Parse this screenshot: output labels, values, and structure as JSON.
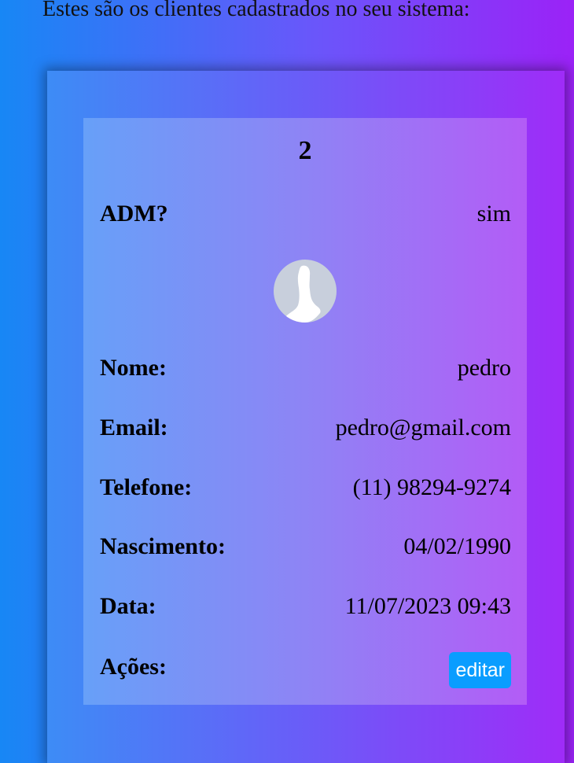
{
  "intro_text": "Estes são os clientes cadastrados no seu sistema:",
  "client": {
    "id": "2",
    "admin_label": "ADM?",
    "admin_value": "sim",
    "avatar_icon": "default-user-silhouette-icon",
    "fields": {
      "name_label": "Nome:",
      "name_value": "pedro",
      "email_label": "Email:",
      "email_value": "pedro@gmail.com",
      "phone_label": "Telefone:",
      "phone_value": "(11) 98294-9274",
      "birth_label": "Nascimento:",
      "birth_value": "04/02/1990",
      "date_label": "Data:",
      "date_value": "11/07/2023 09:43",
      "actions_label": "Ações:"
    },
    "edit_button_label": "editar"
  },
  "colors": {
    "button": "#0a9dff",
    "avatar_bg": "#c8cfdc"
  }
}
